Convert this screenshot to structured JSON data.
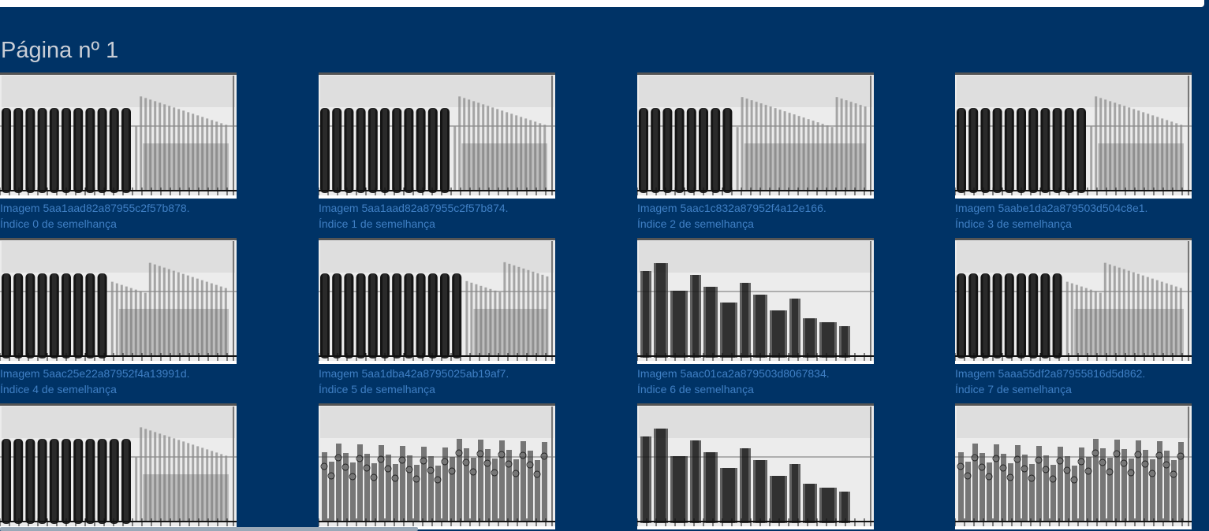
{
  "page": {
    "title": "Página nº 1"
  },
  "results": [
    {
      "caption": "Imagem 5aa1aad82a87955c2f57b878.",
      "index_label": "Índice 0 de semelhança",
      "pattern": "A",
      "dark": 11
    },
    {
      "caption": "Imagem 5aa1aad82a87955c2f57b874.",
      "index_label": "Índice 1 de semelhança",
      "pattern": "A",
      "dark": 11
    },
    {
      "caption": "Imagem 5aac1c832a87952f4a12e166.",
      "index_label": "Índice 2 de semelhança",
      "pattern": "A",
      "dark": 8
    },
    {
      "caption": "Imagem 5aabe1da2a879503d504c8e1.",
      "index_label": "Índice 3 de semelhança",
      "pattern": "A",
      "dark": 11
    },
    {
      "caption": "Imagem 5aac25e22a87952f4a13991d.",
      "index_label": "Índice 4 de semelhança",
      "pattern": "A",
      "dark": 9
    },
    {
      "caption": "Imagem 5aa1dba42a8795025ab19af7.",
      "index_label": "Índice 5 de semelhança",
      "pattern": "A",
      "dark": 12
    },
    {
      "caption": "Imagem 5aac01ca2a879503d8067834.",
      "index_label": "Índice 6 de semelhança",
      "pattern": "B",
      "dark": 0
    },
    {
      "caption": "Imagem 5aaa55df2a87955816d5d862.",
      "index_label": "Índice 7 de semelhança",
      "pattern": "A",
      "dark": 9
    },
    {
      "caption": "",
      "index_label": "",
      "pattern": "A",
      "dark": 11
    },
    {
      "caption": "",
      "index_label": "",
      "pattern": "C",
      "dark": 0
    },
    {
      "caption": "",
      "index_label": "",
      "pattern": "B",
      "dark": 0
    },
    {
      "caption": "",
      "index_label": "",
      "pattern": "C",
      "dark": 0
    }
  ],
  "colors": {
    "background": "#003366",
    "caption": "#3f7fc4",
    "title": "#c9ced6"
  }
}
